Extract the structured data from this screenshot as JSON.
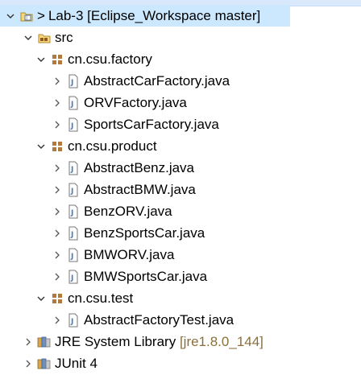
{
  "project": {
    "dirty_marker": ">",
    "name": "Lab-3",
    "repo_decoration": "[Eclipse_Workspace master]"
  },
  "src": {
    "label": "src"
  },
  "packages": [
    {
      "label": "cn.csu.factory",
      "files": [
        "AbstractCarFactory.java",
        "ORVFactory.java",
        "SportsCarFactory.java"
      ]
    },
    {
      "label": "cn.csu.product",
      "files": [
        "AbstractBenz.java",
        "AbstractBMW.java",
        "BenzORV.java",
        "BenzSportsCar.java",
        "BMWORV.java",
        "BMWSportsCar.java"
      ]
    },
    {
      "label": "cn.csu.test",
      "files": [
        "AbstractFactoryTest.java"
      ]
    }
  ],
  "libraries": [
    {
      "label": "JRE System Library",
      "decoration": "[jre1.8.0_144]"
    },
    {
      "label": "JUnit 4",
      "decoration": ""
    }
  ],
  "colors": {
    "selection": "#cce8ff",
    "decoration": "#8a6f3c",
    "package": "#b07a3c",
    "file": "#4b79b8"
  }
}
